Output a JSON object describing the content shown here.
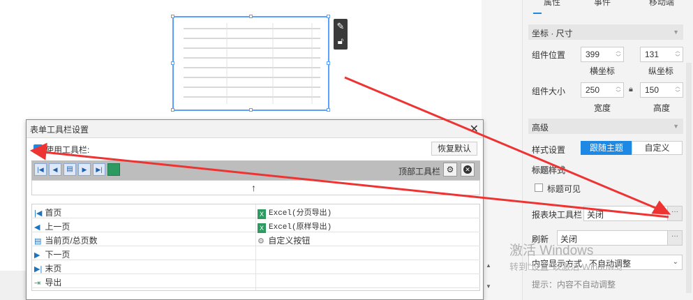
{
  "panel": {
    "tabs": [
      "属性",
      "事件",
      "移动端"
    ],
    "section_coords": "坐标 · 尺寸",
    "pos_label": "组件位置",
    "pos_x": "399",
    "pos_y": "131",
    "x_caption": "横坐标",
    "y_caption": "纵坐标",
    "size_label": "组件大小",
    "width": "250",
    "height": "150",
    "w_caption": "宽度",
    "h_caption": "高度",
    "section_adv": "高级",
    "style_label": "样式设置",
    "style_follow": "跟随主题",
    "style_custom": "自定义",
    "title_style": "标题样式",
    "title_visible": "标题可见",
    "toolbar_label": "报表块工具栏",
    "toolbar_value": "关闭",
    "refresh_label": "刷新",
    "refresh_value": "关闭",
    "content_label": "内容显示方式",
    "content_value": "不自动调整",
    "hint": "提示：内容不自动调整"
  },
  "watermark": {
    "line1": "激活 Windows",
    "line2": "转到\"设置\"以激活 Windows。"
  },
  "dialog": {
    "title": "表单工具栏设置",
    "use_toolbar": "使用工具栏:",
    "restore": "恢复默认",
    "top_toolbar": "顶部工具栏",
    "left_items": [
      "首页",
      "上一页",
      "当前页/总页数",
      "下一页",
      "末页",
      "导出"
    ],
    "right_items": [
      "Excel(分页导出)",
      "Excel(原样导出)",
      "自定义按钮"
    ]
  },
  "colors": {
    "accent": "#1e88e5",
    "selection": "#5aa0ff",
    "arrow": "#ee3333"
  }
}
